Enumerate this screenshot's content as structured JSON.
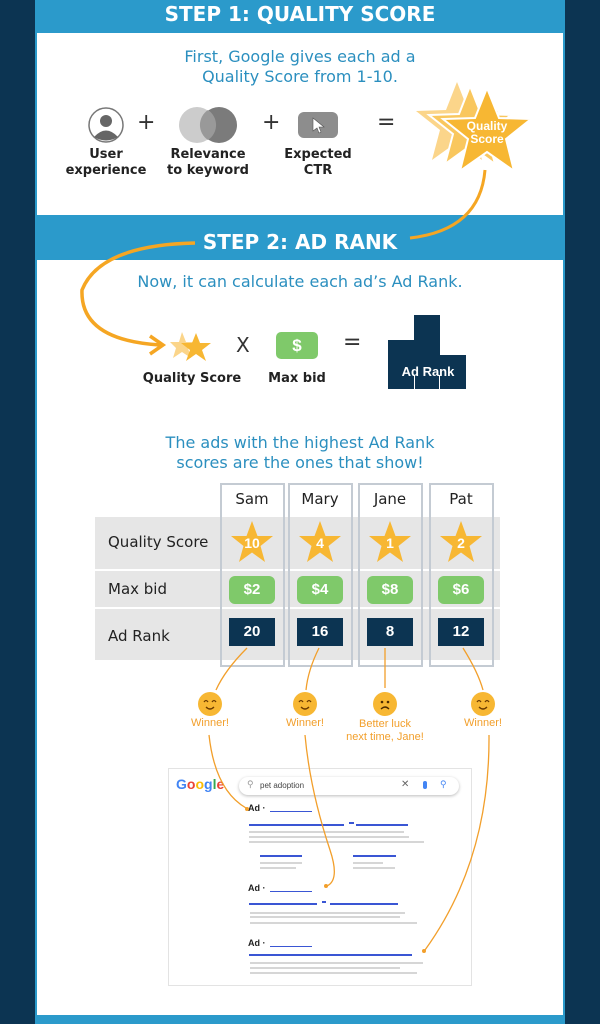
{
  "step1": {
    "title": "STEP 1: QUALITY SCORE",
    "intro": [
      "First, Google gives each ad a",
      "Quality Score from 1-10."
    ],
    "factors": [
      {
        "icon": "user-icon",
        "label": [
          "User",
          "experience"
        ]
      },
      {
        "icon": "venn-icon",
        "label": [
          "Relevance",
          "to keyword"
        ]
      },
      {
        "icon": "cursor-icon",
        "label": [
          "Expected",
          "CTR"
        ]
      }
    ],
    "plus": "+",
    "equals": "=",
    "result": [
      "Quality",
      "Score"
    ]
  },
  "step2": {
    "title": "STEP 2: AD RANK",
    "intro": "Now, it can calculate each ad’s Ad Rank.",
    "formula": {
      "a": "Quality Score",
      "times": "X",
      "b": "Max bid",
      "b_icon": "$",
      "equals": "=",
      "result": "Ad Rank"
    },
    "outro": [
      "The ads with the highest Ad Rank",
      "scores are the ones that show!"
    ]
  },
  "table": {
    "rows": [
      "Quality Score",
      "Max bid",
      "Ad Rank"
    ],
    "columns": [
      {
        "name": "Sam",
        "quality": "10",
        "bid": "$2",
        "rank": "20",
        "outcome": "Winner!",
        "mood": "happy"
      },
      {
        "name": "Mary",
        "quality": "4",
        "bid": "$4",
        "rank": "16",
        "outcome": "Winner!",
        "mood": "happy"
      },
      {
        "name": "Jane",
        "quality": "1",
        "bid": "$8",
        "rank": "8",
        "outcome": "Better luck next time, Jane!",
        "outcome_lines": [
          "Better luck",
          "next time, Jane!"
        ],
        "mood": "sad"
      },
      {
        "name": "Pat",
        "quality": "2",
        "bid": "$6",
        "rank": "12",
        "outcome": "Winner!",
        "mood": "happy"
      }
    ]
  },
  "serp": {
    "logo": "Google",
    "query": "pet adoption",
    "ad_label": "Ad ·"
  },
  "colors": {
    "navy": "#0c3452",
    "blue": "#2b9acb",
    "orange": "#f5a623",
    "green": "#7fc96a",
    "star": "#f7b733"
  }
}
